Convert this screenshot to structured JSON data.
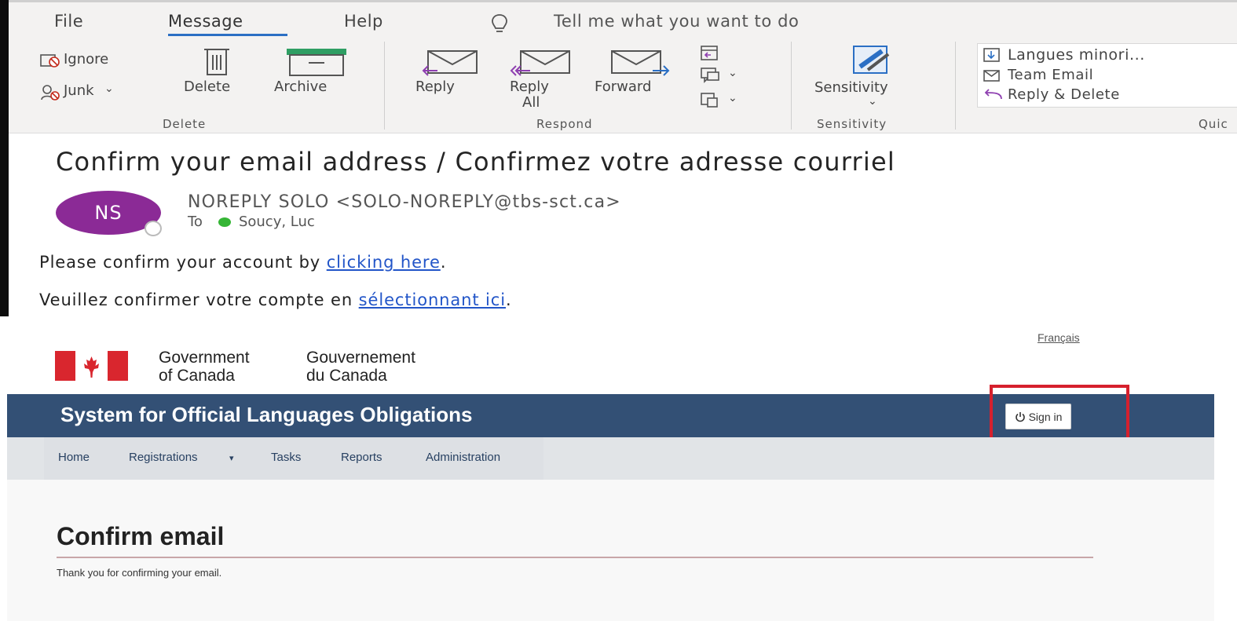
{
  "outlook": {
    "menu": {
      "tabs": [
        "File",
        "Message",
        "Help"
      ],
      "active_tab": "Message",
      "tell_me": "Tell me what you want to do"
    },
    "ribbon": {
      "delete_group": {
        "ignore": "Ignore",
        "junk": "Junk",
        "delete": "Delete",
        "archive": "Archive",
        "group_label": "Delete"
      },
      "respond_group": {
        "reply": "Reply",
        "reply_all_line1": "Reply",
        "reply_all_line2": "All",
        "forward": "Forward",
        "group_label": "Respond"
      },
      "sensitivity_group": {
        "sensitivity": "Sensitivity",
        "group_label": "Sensitivity"
      },
      "quick_steps_group": {
        "items": [
          "Langues minori...",
          "Team Email",
          "Reply & Delete"
        ],
        "group_label": "Quic"
      }
    },
    "email": {
      "subject": "Confirm your email address / Confirmez votre adresse courriel",
      "avatar_initials": "NS",
      "sender": "NOREPLY SOLO <SOLO-NOREPLY@tbs-sct.ca>",
      "to_label": "To",
      "recipient": "Soucy, Luc",
      "line1_before": "Please confirm your account by ",
      "line1_link": "clicking here",
      "line1_after": ".",
      "line2_before": "Veuillez confirmer votre compte en ",
      "line2_link": "sélectionnant ici",
      "line2_after": "."
    }
  },
  "gc_site": {
    "language_link": "Français",
    "wordmark": {
      "en_line1": "Government",
      "en_line2": "of Canada",
      "fr_line1": "Gouvernement",
      "fr_line2": "du Canada"
    },
    "site_title": "System for Official Languages Obligations",
    "sign_in": "Sign in",
    "nav": [
      "Home",
      "Registrations",
      "Tasks",
      "Reports",
      "Administration"
    ],
    "page_title": "Confirm email",
    "page_text": "Thank you for confirming your email.",
    "colors": {
      "title_bar": "#335075",
      "highlight_box": "#d6202d",
      "flag_red": "#d9262e",
      "avatar": "#8b2a96"
    }
  }
}
